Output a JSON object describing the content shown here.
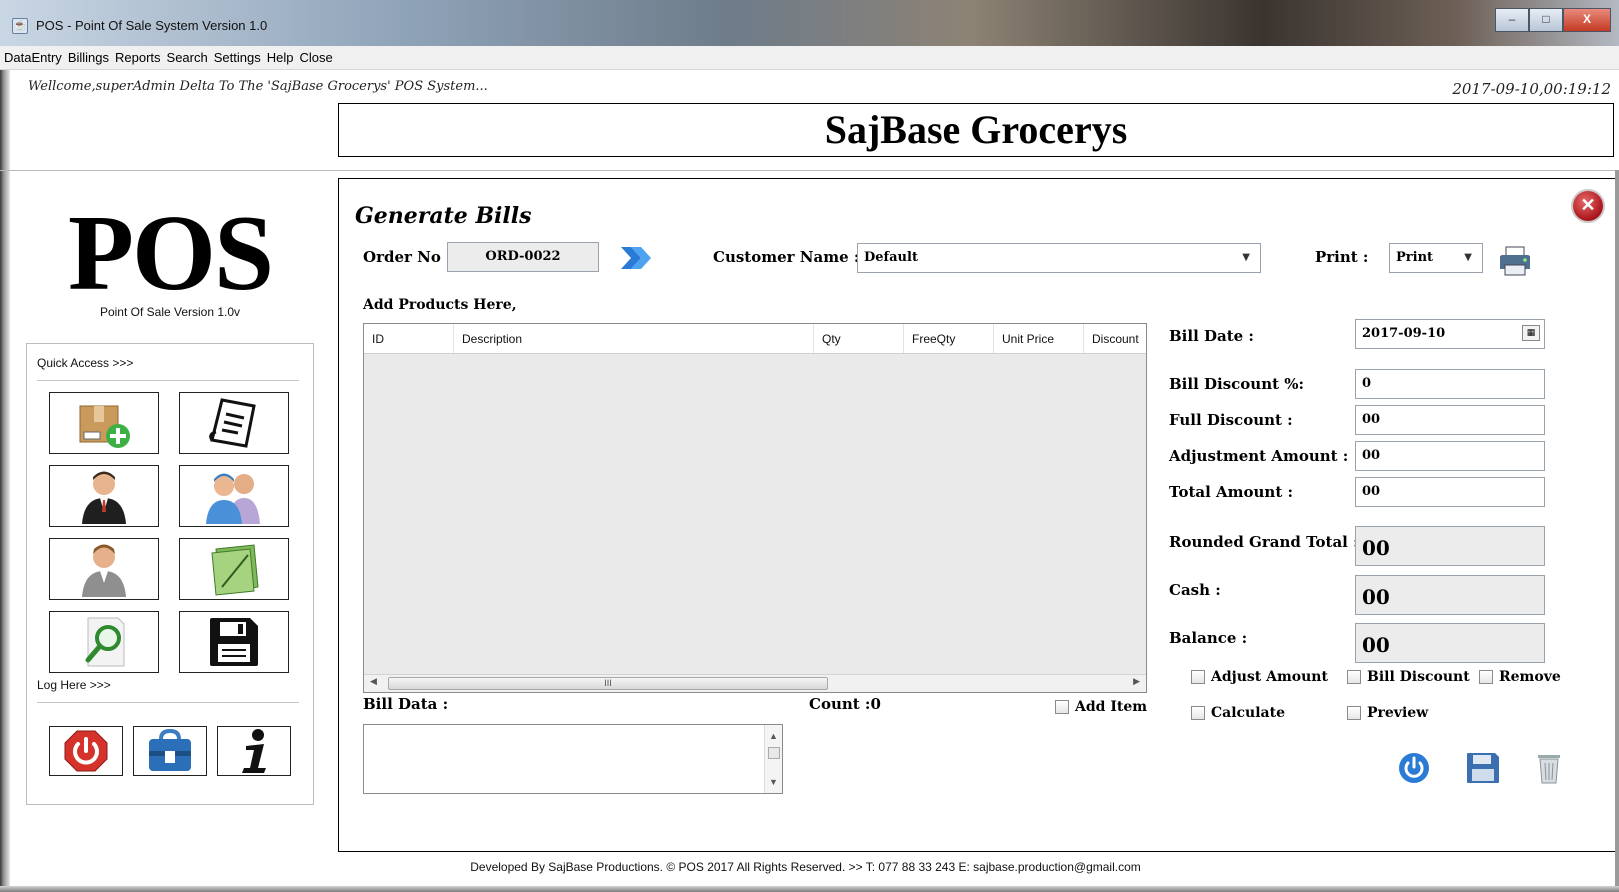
{
  "window": {
    "title": "POS - Point Of Sale System Version 1.0",
    "minimize": "–",
    "maximize": "□",
    "close": "X"
  },
  "menu": [
    "DataEntry",
    "Billings",
    "Reports",
    "Search",
    "Settings",
    "Help",
    "Close"
  ],
  "header": {
    "welcome": "Wellcome,superAdmin Delta To The 'SajBase Grocerys'  POS System...",
    "datetime": "2017-09-10,00:19:12",
    "brand": "SajBase Grocerys"
  },
  "sidebar": {
    "logo": "POS",
    "subtitle": "Point Of Sale Version 1.0v",
    "quick_access_label": "Quick Access >>>",
    "quick_access_icons": [
      "add-product-icon",
      "bill-list-icon",
      "admin-user-icon",
      "employees-icon",
      "customer-icon",
      "notes-icon",
      "search-icon",
      "save-disk-icon"
    ],
    "log_label": "Log Here >>>",
    "log_icons": [
      "power-icon",
      "lock-icon",
      "info-icon"
    ]
  },
  "form": {
    "title": "Generate Bills",
    "order_no_label": "Order No :",
    "order_no": "ORD-0022",
    "customer_label": "Customer Name :",
    "customer_value": "Default",
    "print_label": "Print :",
    "print_value": "Print",
    "add_products_label": "Add Products Here,",
    "columns": [
      "ID",
      "Description",
      "Qty",
      "FreeQty",
      "Unit Price",
      "Discount"
    ],
    "scroll_grip": "III",
    "bill_data_label": "Bill Data :",
    "count_text": "Count :0",
    "add_item_label": "Add Item",
    "bill_date_label": "Bill Date :",
    "bill_date": "2017-09-10",
    "bill_discount_label": "Bill Discount %:",
    "bill_discount": "0",
    "full_discount_label": "Full Discount :",
    "full_discount": "00",
    "adjustment_label": "Adjustment Amount :",
    "adjustment": "00",
    "total_label": "Total Amount :",
    "total": "00",
    "rounded_label": "Rounded Grand Total :",
    "rounded": "00",
    "cash_label": "Cash :",
    "cash": "00",
    "balance_label": "Balance :",
    "balance": "00",
    "checkboxes": {
      "adjust_amount": "Adjust Amount",
      "bill_discount": "Bill Discount",
      "remove": "Remove",
      "calculate": "Calculate",
      "preview": "Preview"
    }
  },
  "footer": "Developed By SajBase Productions. © POS 2017 All Rights Reserved.  >>  T: 077 88 33 243 E: sajbase.production@gmail.com"
}
